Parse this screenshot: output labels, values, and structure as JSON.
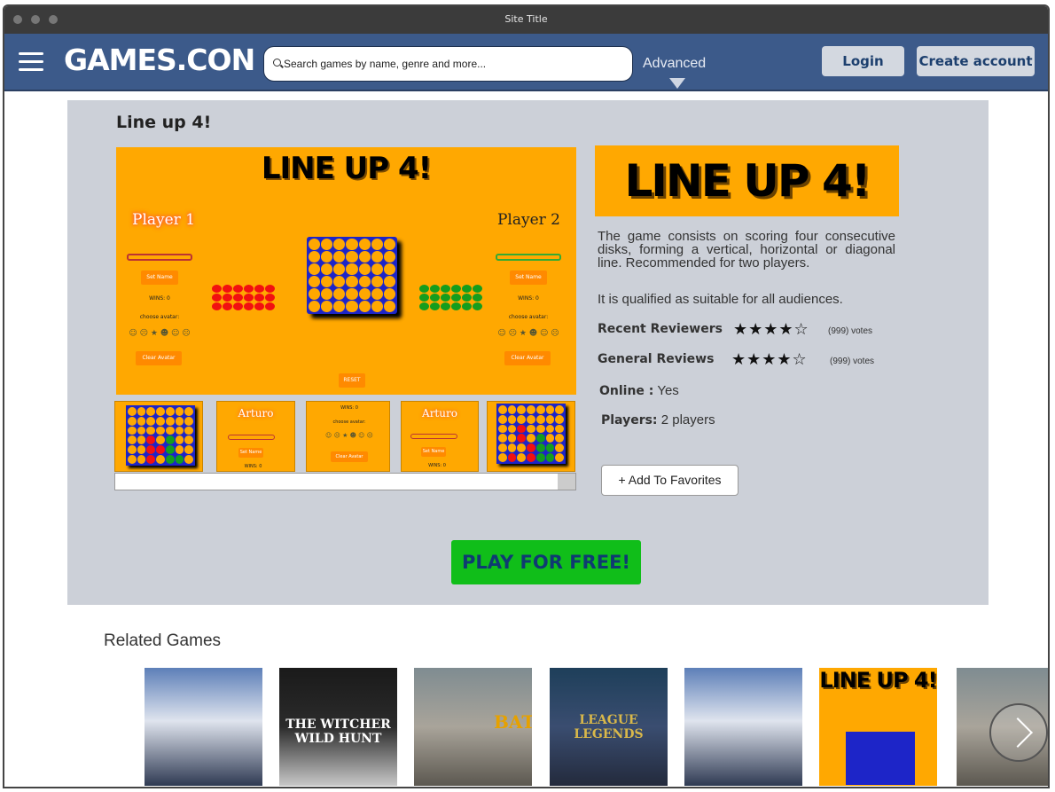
{
  "window": {
    "title": "Site Title"
  },
  "nav": {
    "logo": "GAMES.CON",
    "search_placeholder": "Search games by name, genre and more...",
    "advanced_label": "Advanced",
    "login_label": "Login",
    "create_account_label": "Create account"
  },
  "game": {
    "title": "Line up 4!",
    "screenshot_title": "LINE UP 4!",
    "player1_label": "Player 1",
    "player2_label": "Player 2",
    "set_name_label": "Set Name",
    "wins_label": "WINS: 0",
    "choose_avatar_label": "choose avatar:",
    "clear_avatar_label": "Clear Avatar",
    "reset_label": "RESET",
    "thumb_name": "Arturo",
    "logo_text": "LINE UP 4!",
    "description": "The game consists on scoring four consecutive disks, forming a vertical, horizontal or diagonal line. Recommended for two players.",
    "qualification": "It is qualified as suitable for all audiences.",
    "recent_reviewers_label": "Recent Reviewers",
    "recent_reviewers_rating": 4,
    "recent_reviewers_votes": "(999) votes",
    "general_reviews_label": "General Reviews",
    "general_reviews_rating": 4,
    "general_reviews_votes": "(999) votes",
    "online_label": "Online :",
    "online_value": "Yes",
    "players_label": "Players:",
    "players_value": "2 players",
    "add_favorites_label": "+ Add To Favorites",
    "play_label": "PLAY FOR FREE!"
  },
  "related": {
    "title": "Related Games",
    "items": [
      {
        "caption": "",
        "icon": "football-team-image"
      },
      {
        "caption": "THE WITCHER WILD HUNT",
        "icon": "witcher-image"
      },
      {
        "caption": "BAT",
        "icon": "pubg-image"
      },
      {
        "caption": "LEAGUE LEGENDS",
        "icon": "league-image"
      },
      {
        "caption": "",
        "icon": "football-team-image"
      },
      {
        "caption": "LINE UP 4!",
        "icon": "lineup4-image"
      },
      {
        "caption": "",
        "icon": "pubg-image"
      }
    ]
  },
  "colors": {
    "accent": "#3c5a8a",
    "play": "#10be19",
    "game_bg": "#ffa801",
    "board": "#1d25c8"
  }
}
